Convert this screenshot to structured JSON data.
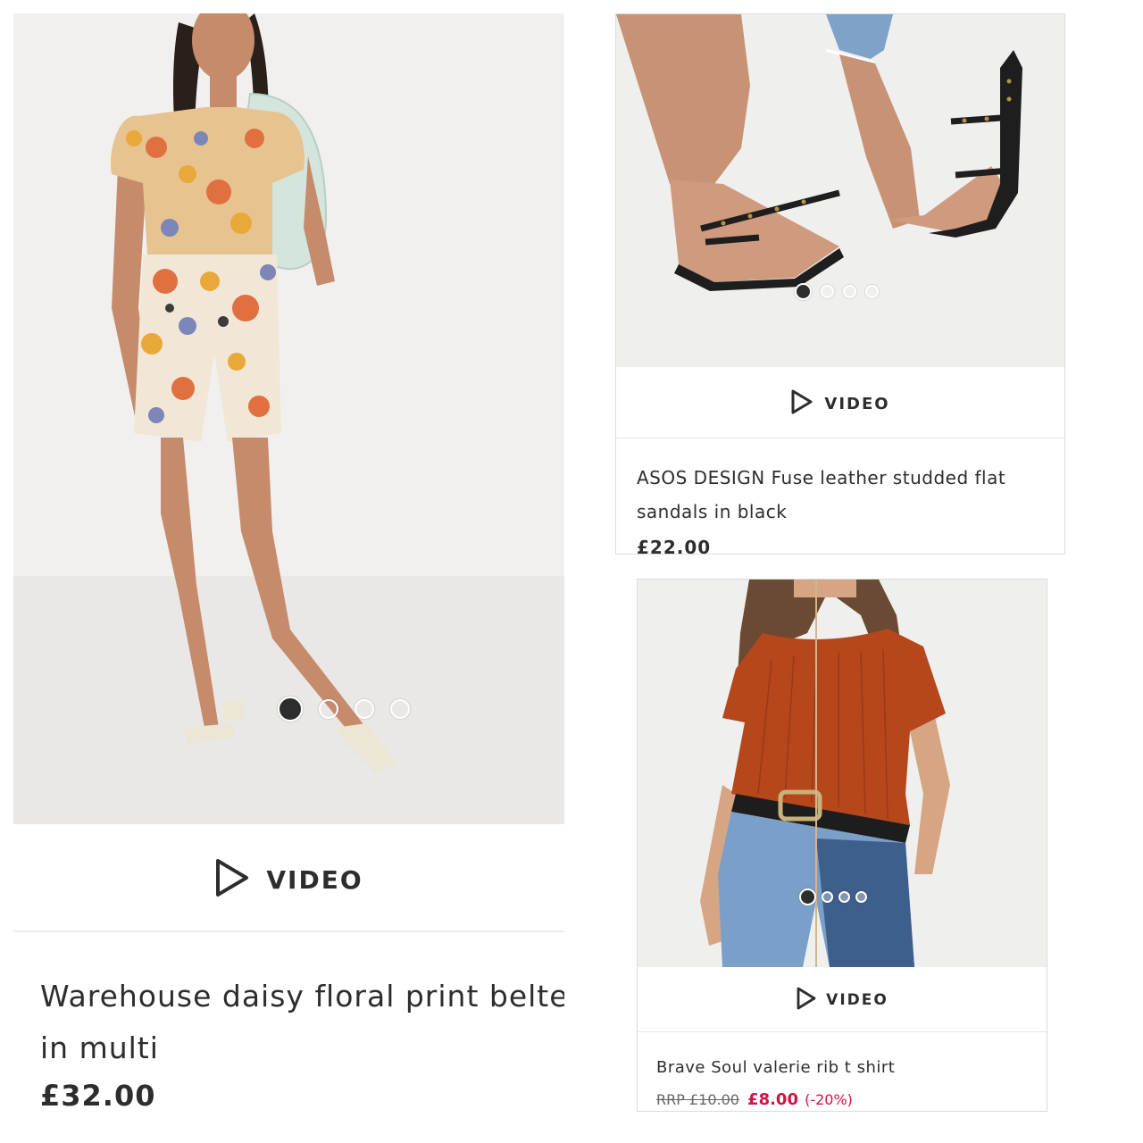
{
  "products": [
    {
      "title": "Warehouse daisy floral print belted s",
      "title_line2": "in multi",
      "price": "£32.00",
      "video_label": "VIDEO"
    },
    {
      "title": "ASOS DESIGN Fuse leather studded flat",
      "title_line2": "sandals in black",
      "price": "£22.00",
      "video_label": "VIDEO"
    },
    {
      "title": "Brave Soul valerie rib t shirt",
      "rrp": "RRP £10.00",
      "sale_price": "£8.00",
      "discount": "(-20%)",
      "video_label": "VIDEO"
    }
  ],
  "carousel": {
    "count": 4,
    "active": 0
  },
  "colors": {
    "sale": "#d01345",
    "text": "#2d2d2d"
  },
  "icons": {
    "play": "play-outline-icon"
  }
}
